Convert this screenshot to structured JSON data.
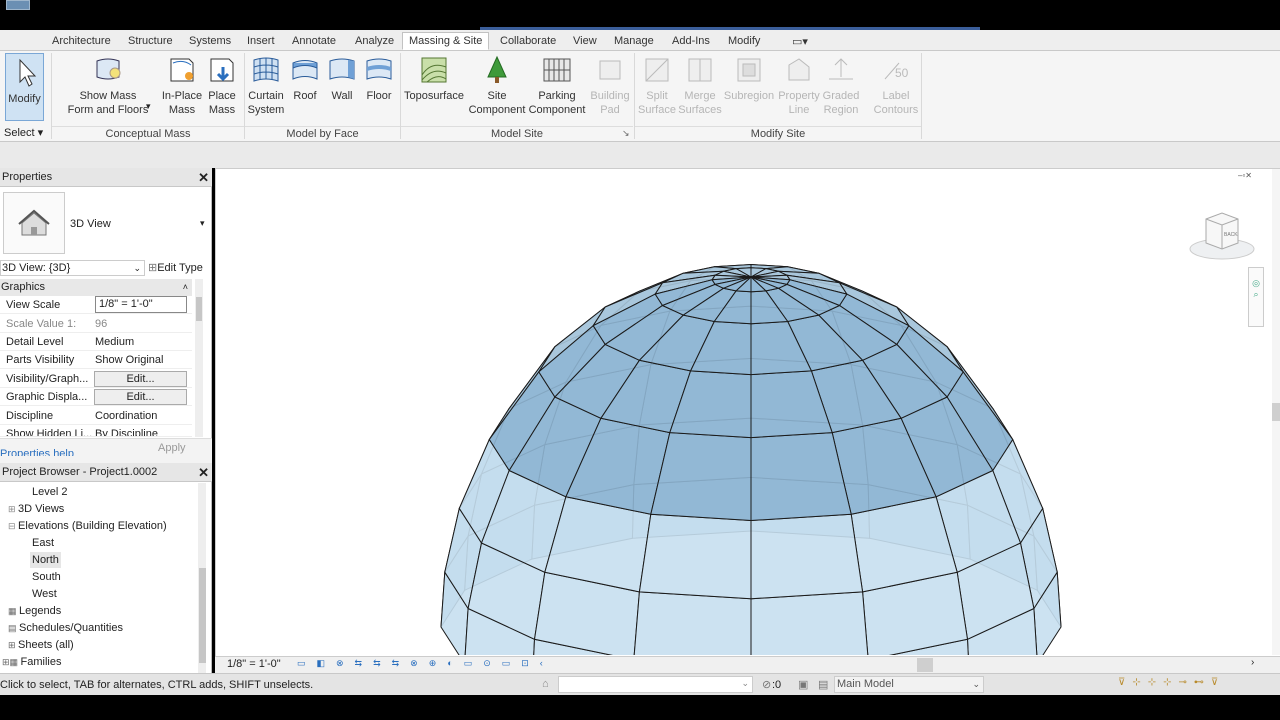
{
  "ribbon_tabs": [
    "Architecture",
    "Structure",
    "Systems",
    "Insert",
    "Annotate",
    "Analyze",
    "Massing & Site",
    "Collaborate",
    "View",
    "Manage",
    "Add-Ins",
    "Modify"
  ],
  "active_tab": "Massing & Site",
  "ribbon": {
    "modify": "Modify",
    "select": "Select",
    "show_mass_1": "Show Mass",
    "show_mass_2": "Form and Floors",
    "inplace_1": "In-Place",
    "inplace_2": "Mass",
    "place_1": "Place",
    "place_2": "Mass",
    "curtain_1": "Curtain",
    "curtain_2": "System",
    "roof": "Roof",
    "wall": "Wall",
    "floor": "Floor",
    "toposurface": "Toposurface",
    "site_1": "Site",
    "site_2": "Component",
    "parking_1": "Parking",
    "parking_2": "Component",
    "building_1": "Building",
    "building_2": "Pad",
    "split_1": "Split",
    "split_2": "Surface",
    "merge_1": "Merge",
    "merge_2": "Surfaces",
    "subregion": "Subregion",
    "property_1": "Property",
    "property_2": "Line",
    "graded_1": "Graded",
    "graded_2": "Region",
    "label_1": "Label",
    "label_2": "Contours",
    "panels": {
      "conceptual_mass": "Conceptual Mass",
      "model_by_face": "Model by Face",
      "model_site": "Model Site",
      "modify_site": "Modify Site"
    }
  },
  "properties": {
    "title": "Properties",
    "type_name": "3D View",
    "view_selector": "3D View: {3D}",
    "edit_type": "Edit Type",
    "section": "Graphics",
    "rows": [
      {
        "k": "View Scale",
        "v": "1/8\" = 1'-0\""
      },
      {
        "k": "Scale Value    1:",
        "v": "96"
      },
      {
        "k": "Detail Level",
        "v": "Medium"
      },
      {
        "k": "Parts Visibility",
        "v": "Show Original"
      },
      {
        "k": "Visibility/Graph...",
        "v": "Edit..."
      },
      {
        "k": "Graphic Displa...",
        "v": "Edit..."
      },
      {
        "k": "Discipline",
        "v": "Coordination"
      },
      {
        "k": "Show Hidden Li...",
        "v": "By Discipline"
      }
    ],
    "help": "Properties help",
    "apply": "Apply"
  },
  "browser": {
    "title": "Project Browser - Project1.0002",
    "nodes": [
      "Level 2",
      "3D Views",
      "Elevations (Building Elevation)",
      "East",
      "North",
      "South",
      "West",
      "Legends",
      "Schedules/Quantities",
      "Sheets (all)",
      "Families"
    ]
  },
  "view": {
    "scale": "1/8\" = 1'-0\"",
    "cube_label": "BACK"
  },
  "status": {
    "text": "Click to select, TAB for alternates, CTRL adds, SHIFT unselects.",
    "count": ":0",
    "model": "Main Model"
  }
}
